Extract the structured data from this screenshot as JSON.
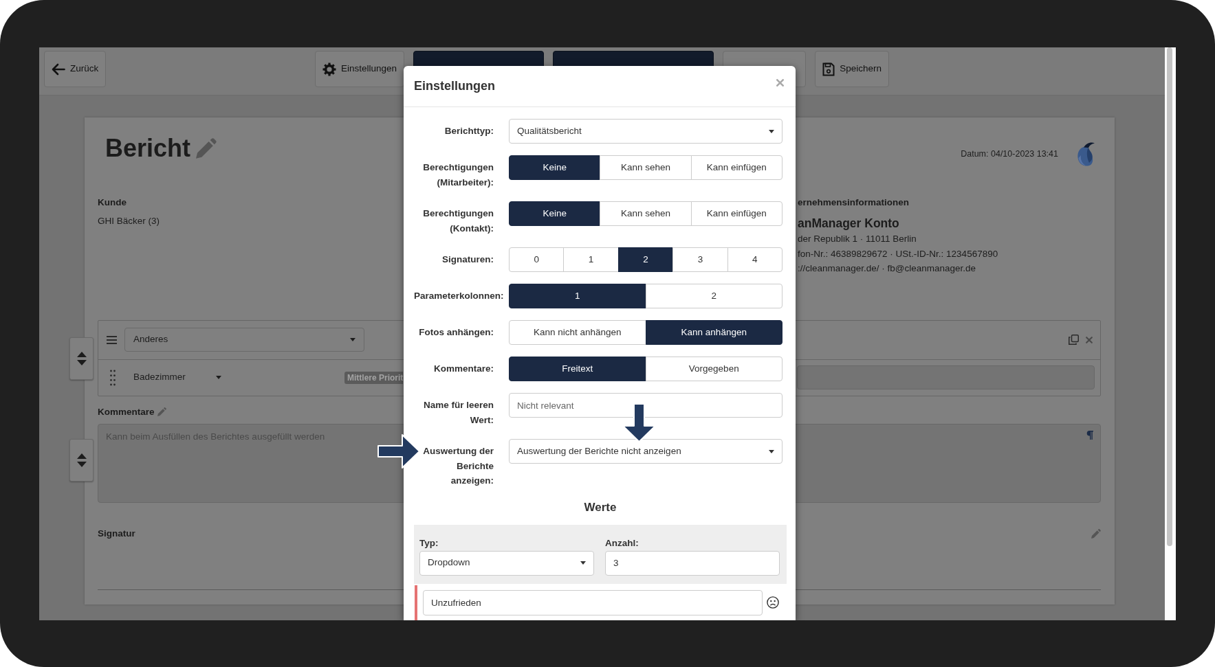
{
  "toolbar": {
    "back": "Zurück",
    "buttons": [
      {
        "kind": "settings",
        "label": "Einstellungen"
      },
      {
        "kind": "primary"
      },
      {
        "kind": "primary"
      },
      {
        "kind": "default"
      },
      {
        "kind": "save",
        "label": "Speichern"
      }
    ]
  },
  "report": {
    "title": "Bericht",
    "date": "Datum: 04/10-2023 13:41",
    "customer_label": "Kunde",
    "customer": "GHI Bäcker (3)",
    "company": {
      "heading": "ernehmensinformationen",
      "name": "anManager Konto",
      "lines": [
        "der Republik 1 · 11011 Berlin",
        "fon-Nr.: 46389829672 · USt.-ID-Nr.: 1234567890",
        "://cleanmanager.de/ · fb@cleanmanager.de"
      ]
    },
    "section": {
      "category": "Anderes",
      "room": "Badezimmer",
      "priority": "Mittlere Priorit"
    },
    "comments_label": "Kommentare",
    "comments_placeholder": "Kann beim Ausfüllen des Berichtes ausgefüllt werden",
    "signature_label": "Signatur"
  },
  "dialog": {
    "title": "Einstellungen",
    "fields": [
      {
        "kind": "select",
        "label": "Berichttyp:",
        "value": "Qualitätsbericht"
      },
      {
        "kind": "toggle",
        "label": "Berechtigungen (Mitarbeiter):",
        "options": [
          {
            "label": "Keine",
            "selected": true
          },
          {
            "label": "Kann sehen",
            "selected": false
          },
          {
            "label": "Kann einfügen",
            "selected": false
          }
        ]
      },
      {
        "kind": "toggle",
        "label": "Berechtigungen (Kontakt):",
        "options": [
          {
            "label": "Keine",
            "selected": true
          },
          {
            "label": "Kann sehen",
            "selected": false
          },
          {
            "label": "Kann einfügen",
            "selected": false
          }
        ]
      },
      {
        "kind": "toggle",
        "label": "Signaturen:",
        "options": [
          {
            "label": "0",
            "selected": false
          },
          {
            "label": "1",
            "selected": false
          },
          {
            "label": "2",
            "selected": true
          },
          {
            "label": "3",
            "selected": false
          },
          {
            "label": "4",
            "selected": false
          }
        ]
      },
      {
        "kind": "toggle",
        "label": "Parameterkolonnen:",
        "options": [
          {
            "label": "1",
            "selected": true
          },
          {
            "label": "2",
            "selected": false
          }
        ]
      },
      {
        "kind": "toggle",
        "label": "Fotos anhängen:",
        "options": [
          {
            "label": "Kann nicht anhängen",
            "selected": false
          },
          {
            "label": "Kann anhängen",
            "selected": true
          }
        ]
      },
      {
        "kind": "toggle",
        "label": "Kommentare:",
        "options": [
          {
            "label": "Freitext",
            "selected": true
          },
          {
            "label": "Vorgegeben",
            "selected": false
          }
        ]
      },
      {
        "kind": "text",
        "label": "Name für leeren Wert:",
        "placeholder": "Nicht relevant"
      },
      {
        "kind": "select",
        "label": "Auswertung der Berichte anzeigen:",
        "value": "Auswertung der Berichte nicht anzeigen"
      }
    ],
    "values_heading": "Werte",
    "type_label": "Typ:",
    "type_value": "Dropdown",
    "count_label": "Anzahl:",
    "count_value": "3",
    "values": [
      {
        "value": "Unzufrieden",
        "color": "#e57373"
      }
    ]
  },
  "annotations": [
    {
      "kind": "rightarrow"
    },
    {
      "kind": "downarrow"
    }
  ]
}
